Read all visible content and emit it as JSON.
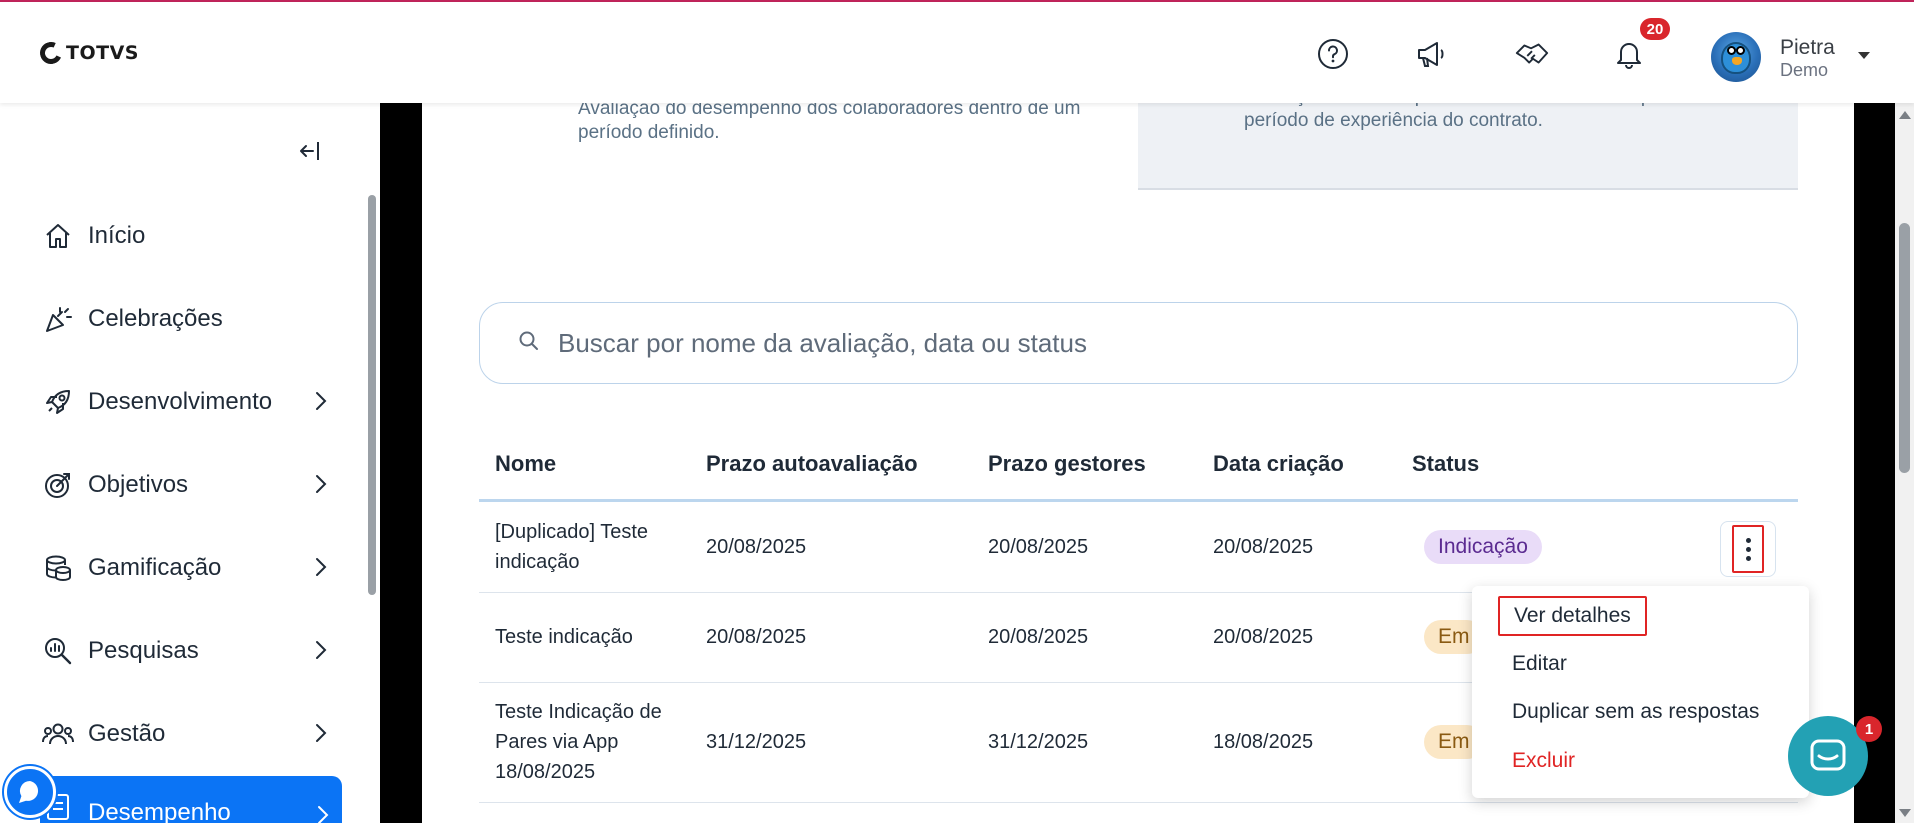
{
  "brand": {
    "logo_text": "TOTVS"
  },
  "header": {
    "notification_count": "20",
    "user": {
      "name": "Pietra",
      "role": "Demo"
    }
  },
  "sidebar": {
    "items": [
      {
        "label": "Início",
        "icon": "home-icon"
      },
      {
        "label": "Celebrações",
        "icon": "party-icon"
      },
      {
        "label": "Desenvolvimento",
        "icon": "rocket-icon"
      },
      {
        "label": "Objetivos",
        "icon": "target-icon"
      },
      {
        "label": "Gamificação",
        "icon": "coins-icon"
      },
      {
        "label": "Pesquisas",
        "icon": "search-chart-icon"
      },
      {
        "label": "Gestão",
        "icon": "team-icon"
      },
      {
        "label": "Desempenho",
        "icon": "checklist-icon",
        "active": true
      }
    ]
  },
  "cards": {
    "card1_desc": "Avaliação do desempenho dos colaboradores dentro de um período definido.",
    "card2_desc": "Avaliação do desempenho dos colaboradores que estão no período de experiência do contrato."
  },
  "search": {
    "placeholder": "Buscar por nome da avaliação, data ou status"
  },
  "table": {
    "headers": [
      "Nome",
      "Prazo autoavaliação",
      "Prazo gestores",
      "Data criação",
      "Status"
    ],
    "rows": [
      {
        "name": "[Duplicado] Teste indicação",
        "self_deadline": "20/08/2025",
        "manager_deadline": "20/08/2025",
        "created": "20/08/2025",
        "status": "Indicação"
      },
      {
        "name": "Teste indicação",
        "self_deadline": "20/08/2025",
        "manager_deadline": "20/08/2025",
        "created": "20/08/2025",
        "status": "Em"
      },
      {
        "name": "Teste Indicação de Pares via App 18/08/2025",
        "self_deadline": "31/12/2025",
        "manager_deadline": "31/12/2025",
        "created": "18/08/2025",
        "status": "Em"
      }
    ]
  },
  "menu": {
    "items": [
      "Ver detalhes",
      "Editar",
      "Duplicar sem as respostas",
      "Excluir"
    ]
  },
  "chat": {
    "badge": "1"
  },
  "colors": {
    "primary": "#0b74f5",
    "accent_line": "#c0245a",
    "danger": "#e02424",
    "chat": "#23a1b4"
  }
}
